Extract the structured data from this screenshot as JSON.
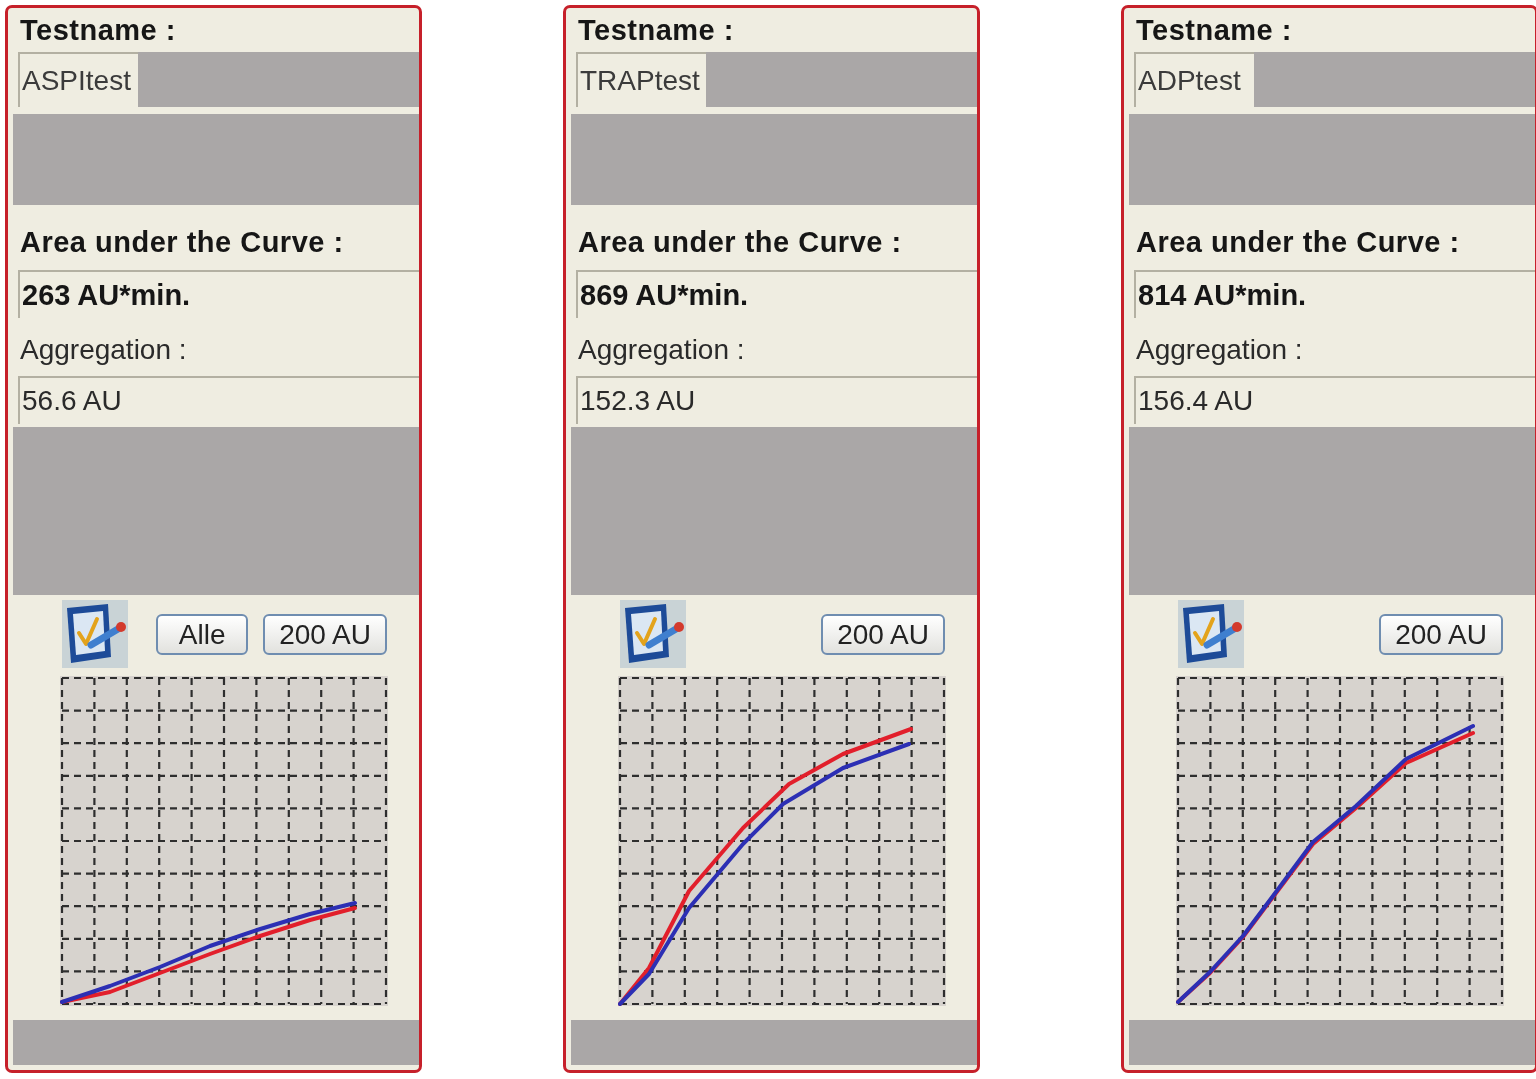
{
  "panels": [
    {
      "testname_label": "Testname :",
      "testname": "ASPItest",
      "auc_label": "Area under the Curve :",
      "auc_value": "263 AU*min.",
      "aggregation_label": "Aggregation :",
      "aggregation_value": "56.6 AU",
      "buttons": [
        "Alle",
        "200 AU"
      ]
    },
    {
      "testname_label": "Testname :",
      "testname": "TRAPtest",
      "auc_label": "Area under the Curve :",
      "auc_value": "869 AU*min.",
      "aggregation_label": "Aggregation :",
      "aggregation_value": "152.3 AU",
      "buttons": [
        "200 AU"
      ]
    },
    {
      "testname_label": "Testname :",
      "testname": "ADPtest",
      "auc_label": "Area under the Curve :",
      "auc_value": "814 AU*min.",
      "aggregation_label": "Aggregation :",
      "aggregation_value": "156.4 AU",
      "buttons": [
        "200 AU"
      ]
    }
  ]
}
